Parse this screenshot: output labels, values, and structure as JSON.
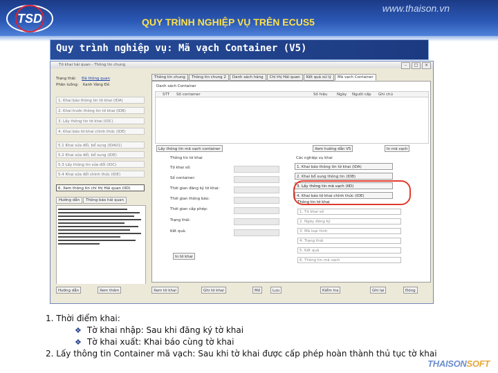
{
  "slide": {
    "logo_text": "TSD",
    "site": "www.thaison.vn",
    "title": "QUY TRÌNH NGHIỆP VỤ TRÊN ECUS5",
    "subtitle": "Quy trình nghiệp vụ: Mã vạch Container (V5)",
    "brand_part1": "THAISON",
    "brand_part2": "SOFT"
  },
  "window": {
    "title": "Tờ khai hải quan - Thông tin chung",
    "left": {
      "row1_label": "Trạng thái:",
      "row1_link": "Đã thông quan",
      "row2_label": "Phân luồng:",
      "row2_options": "Xanh  Vàng  Đỏ",
      "steps": [
        "1. Khai báo thông tin tờ khai (IDA)",
        "2. Khai trước thông tin tờ khai (IDB)",
        "3. Lấy thông tin tờ khai (IDC)",
        "4. Khai báo tờ khai chính thức (IDE)",
        "5.1 Khai sửa đổi, bổ sung (IDA01)",
        "5.2 Khai sửa đổi, bổ sung (IDE)",
        "5.3 Lấy thông tin sửa đổi (IDC)",
        "5.4 Khai sửa đổi chính thức (IDE)",
        "6. Xem thông tin chỉ thị Hải quan (IID)"
      ],
      "subtabs": [
        "Hướng dẫn",
        "Thông báo hải quan"
      ]
    },
    "tabs": [
      "Thông tin chung",
      "Thông tin chung 2",
      "Danh sách hàng",
      "Chỉ thị Hải quan",
      "Kết quả xử lý",
      "Mã vạch Container"
    ],
    "grid_title": "Danh sách Container",
    "grid_cols": [
      "STT",
      "Số container",
      "Số hiệu",
      "Ngày",
      "Người cấp",
      "Ghi chú"
    ],
    "buttons": {
      "scan": "Lấy thông tin mã vạch container",
      "view": "Xem hướng dẫn V5",
      "print": "In mã vạch"
    },
    "fields_title": "Thông tin tờ khai",
    "fields": [
      "Tờ khai số:",
      "Số container:",
      "Thời gian đăng ký tờ khai:",
      "Thời gian thông báo:",
      "Thời gian cấp phép:",
      "Trạng thái:",
      "Kết quả:"
    ],
    "actions_title": "Các nghiệp vụ khai",
    "actions": [
      "1. Khai báo thông tin tờ khai (IDA)",
      "2. Khai bổ sung thông tin (IDB)",
      "3. Lấy thông tin mã vạch (IID)",
      "4. Khai báo tờ khai chính thức (IDE)"
    ],
    "info_title": "Thông tin tờ khai",
    "info_items": [
      "1. Tờ khai số",
      "2. Ngày đăng ký",
      "3. Mã loại hình",
      "4. Trạng thái",
      "5. Kết quả",
      "6. Thông tin mã vạch"
    ],
    "print_button": "In tờ khai",
    "bottom_buttons": [
      "Xem tờ khai",
      "Ghi tờ khai",
      "Mở",
      "Lưu",
      "Kiểm tra",
      "Ghi lại",
      "Đóng"
    ],
    "bottom_row2": [
      "Hướng dẫn",
      "Xem thêm"
    ]
  },
  "notes": [
    "1. Thời điểm khai:",
    "Tờ khai nhập: Sau khi đăng ký tờ khai",
    "Tờ khai xuất: Khai báo cùng tờ khai",
    "2. Lấy thông tin Container mã vạch: Sau khi tờ khai được cấp phép hoàn thành thủ tục tờ khai"
  ],
  "colors": {
    "band": "#1c3a86",
    "title_yellow": "#ffe24a",
    "highlight_ring": "#e03a2a"
  }
}
